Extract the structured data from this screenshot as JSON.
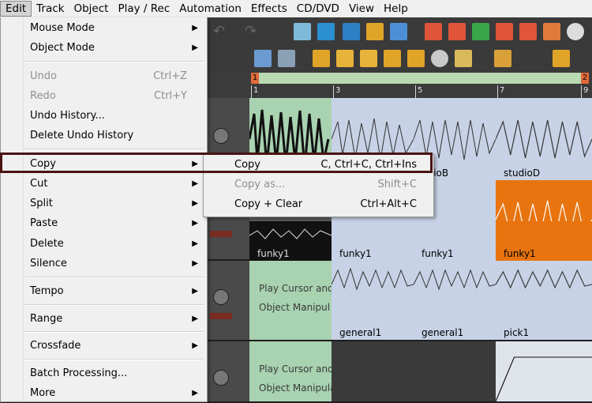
{
  "menubar": {
    "items": [
      "Edit",
      "Track",
      "Object",
      "Play / Rec",
      "Automation",
      "Effects",
      "CD/DVD",
      "View",
      "Help"
    ]
  },
  "ruler": {
    "markers": [
      "1",
      "2"
    ],
    "ticks": [
      "1",
      "3",
      "5",
      "7",
      "9"
    ]
  },
  "tracks": {
    "clip_labels_row1": [
      "udioB",
      "studioD"
    ],
    "clip_labels_row3": [
      "funky1",
      "funky1",
      "funky1",
      "funky1"
    ],
    "clip_labels_row4": [
      "general1",
      "general1",
      "pick1"
    ],
    "lane_text": {
      "row4_a": "Play Cursor and",
      "row4_b": "Object Manipul",
      "row5_a": "Play Cursor and Range Manipulation Area",
      "row5_b": "Object Manipulation Area"
    }
  },
  "edit_menu": {
    "items": [
      {
        "label": "Mouse Mode",
        "shortcut": "",
        "arrow": "▶",
        "disabled": false
      },
      {
        "label": "Object Mode",
        "shortcut": "",
        "arrow": "▶",
        "disabled": false
      },
      {
        "label": "Undo",
        "shortcut": "Ctrl+Z",
        "arrow": "",
        "disabled": true
      },
      {
        "label": "Redo",
        "shortcut": "Ctrl+Y",
        "arrow": "",
        "disabled": true
      },
      {
        "label": "Undo History...",
        "shortcut": "",
        "arrow": "",
        "disabled": false
      },
      {
        "label": "Delete Undo History",
        "shortcut": "",
        "arrow": "",
        "disabled": false
      },
      {
        "label": "Copy",
        "shortcut": "",
        "arrow": "▶",
        "disabled": false
      },
      {
        "label": "Cut",
        "shortcut": "",
        "arrow": "▶",
        "disabled": false
      },
      {
        "label": "Split",
        "shortcut": "",
        "arrow": "▶",
        "disabled": false
      },
      {
        "label": "Paste",
        "shortcut": "",
        "arrow": "▶",
        "disabled": false
      },
      {
        "label": "Delete",
        "shortcut": "",
        "arrow": "▶",
        "disabled": false
      },
      {
        "label": "Silence",
        "shortcut": "",
        "arrow": "▶",
        "disabled": false
      },
      {
        "label": "Tempo",
        "shortcut": "",
        "arrow": "▶",
        "disabled": false
      },
      {
        "label": "Range",
        "shortcut": "",
        "arrow": "▶",
        "disabled": false
      },
      {
        "label": "Crossfade",
        "shortcut": "",
        "arrow": "▶",
        "disabled": false
      },
      {
        "label": "Batch Processing...",
        "shortcut": "",
        "arrow": "",
        "disabled": false
      },
      {
        "label": "More",
        "shortcut": "",
        "arrow": "▶",
        "disabled": false
      }
    ]
  },
  "copy_submenu": {
    "items": [
      {
        "label": "Copy",
        "shortcut": "C, Ctrl+C, Ctrl+Ins",
        "disabled": false
      },
      {
        "label": "Copy as...",
        "shortcut": "Shift+C",
        "disabled": true
      },
      {
        "label": "Copy + Clear",
        "shortcut": "Ctrl+Alt+C",
        "disabled": false
      }
    ]
  },
  "colors": {
    "highlight_frame": "#4a1414",
    "loop_bar": "#b9d9b0",
    "clip_blue": "#c7d2e6",
    "clip_orange": "#e8740f",
    "clip_green": "#a8d2b0"
  }
}
